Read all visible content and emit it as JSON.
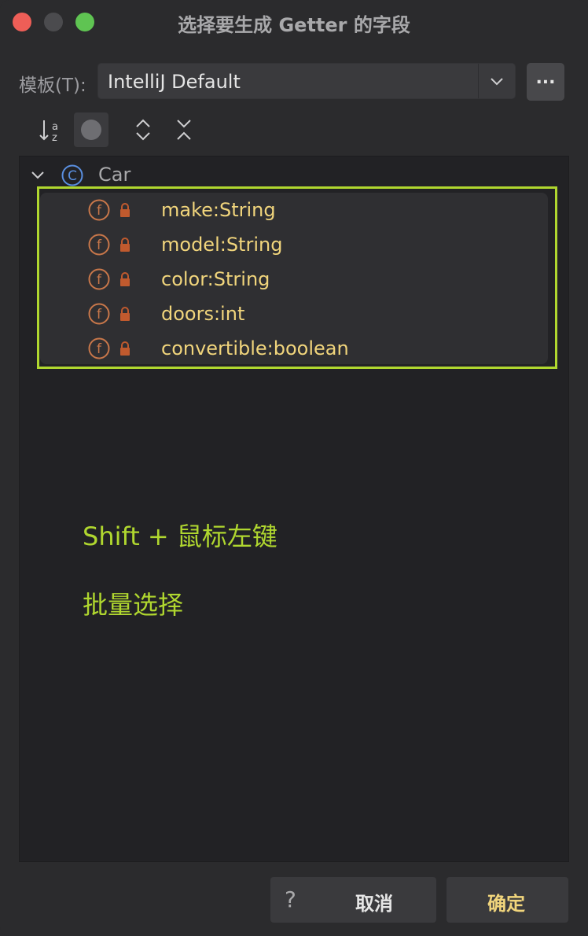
{
  "window": {
    "title": "选择要生成 Getter 的字段"
  },
  "template": {
    "label": "模板(T):",
    "value": "IntelliJ Default",
    "more_label": "..."
  },
  "toolbar": {
    "sort_icon": "sort-alpha-icon",
    "toggle_icon": "circle-toggle-icon",
    "expand_icon": "expand-all-icon",
    "collapse_icon": "collapse-all-icon"
  },
  "tree": {
    "class_name": "Car",
    "fields": [
      {
        "label": "make:String"
      },
      {
        "label": "model:String"
      },
      {
        "label": "color:String"
      },
      {
        "label": "doors:int"
      },
      {
        "label": "convertible:boolean"
      }
    ]
  },
  "annotation": {
    "line1": "Shift + 鼠标左键",
    "line2": "批量选择",
    "color": "#b0d72f"
  },
  "buttons": {
    "help": "?",
    "cancel": "取消",
    "ok": "确定"
  },
  "colors": {
    "field_text": "#f1d57c",
    "field_icon": "#c8774a",
    "class_icon": "#5a8fe0"
  }
}
